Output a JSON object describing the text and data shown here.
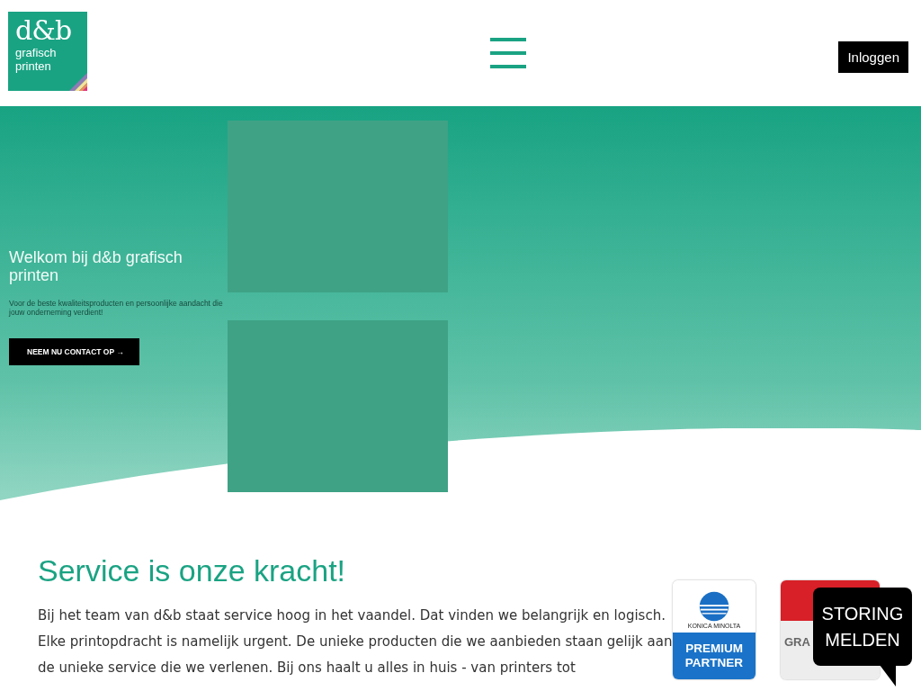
{
  "header": {
    "logo": {
      "mark": "d&b",
      "tagline": [
        "grafisch",
        "printen"
      ]
    },
    "login_button": "Inloggen"
  },
  "hero": {
    "title": "Welkom bij d&b grafisch printen",
    "subtitle": "Voor de beste kwaliteitsproducten en persoonlijke aandacht die jouw onderneming verdient!",
    "button": "NEEM NU CONTACT OP",
    "button_arrow": "→"
  },
  "service": {
    "heading": "Service is onze kracht!",
    "body": "Bij het team van d&b staat service hoog in het vaandel. Dat vinden we belangrijk en logisch. Elke printopdracht is namelijk urgent. De unieke producten die we aanbieden staan gelijk aan de unieke service die we verlenen. Bij ons haalt u alles in huis - van printers tot",
    "badges": [
      {
        "kind": "konica",
        "brand": "KONICA MINOLTA",
        "lines": [
          "PREMIUM",
          "PARTNER"
        ]
      },
      {
        "kind": "canon",
        "lines": [
          "GRA"
        ]
      }
    ]
  },
  "report_button": {
    "lines": [
      "STORING",
      "MELDEN"
    ]
  }
}
